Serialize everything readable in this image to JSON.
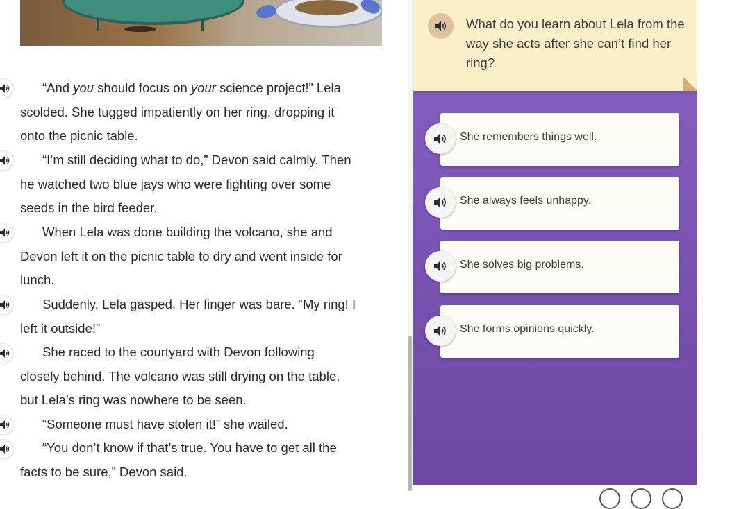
{
  "passage": {
    "paragraphs": [
      {
        "first_line_before": "“And ",
        "first_line_em1": "you",
        "first_line_mid": " should focus on ",
        "first_line_em2": "your",
        "first_line_after": " science project!” Lela",
        "lines": [
          "scolded. She tugged impatiently on her ring, dropping it",
          "onto the picnic table."
        ]
      },
      {
        "first_line": "“I’m still deciding what to do,” Devon said calmly. Then",
        "lines": [
          "he watched two blue jays who were fighting over some",
          "seeds in the bird feeder."
        ]
      },
      {
        "first_line": "When Lela was done building the volcano, she and",
        "lines": [
          "Devon left it on the picnic table to dry and went inside for",
          "lunch."
        ]
      },
      {
        "first_line": "Suddenly, Lela gasped. Her finger was bare. “My ring! I",
        "lines": [
          "left it outside!”"
        ]
      },
      {
        "first_line": "She raced to the courtyard with Devon following",
        "lines": [
          "closely behind. The volcano was still drying on the table,",
          "but Lela’s ring was nowhere to be seen."
        ]
      },
      {
        "first_line": "“Someone must have stolen it!” she wailed.",
        "lines": []
      },
      {
        "first_line": "“You don’t know if that’s true. You have to get all the",
        "lines": [
          "facts to be sure,” Devon said."
        ]
      }
    ]
  },
  "question": {
    "text": "What do you learn about Lela from the way she acts after she can’t find her ring?"
  },
  "choices": [
    {
      "label": "She remembers things well."
    },
    {
      "label": "She always feels unhappy."
    },
    {
      "label": "She solves big problems."
    },
    {
      "label": "She forms opinions quickly."
    }
  ],
  "colors": {
    "panel_purple": "#7d57b8",
    "question_bg": "#fbefc8",
    "choice_bg": "#fdfcf7"
  },
  "icons": {
    "read_aloud": "speaker-icon"
  }
}
